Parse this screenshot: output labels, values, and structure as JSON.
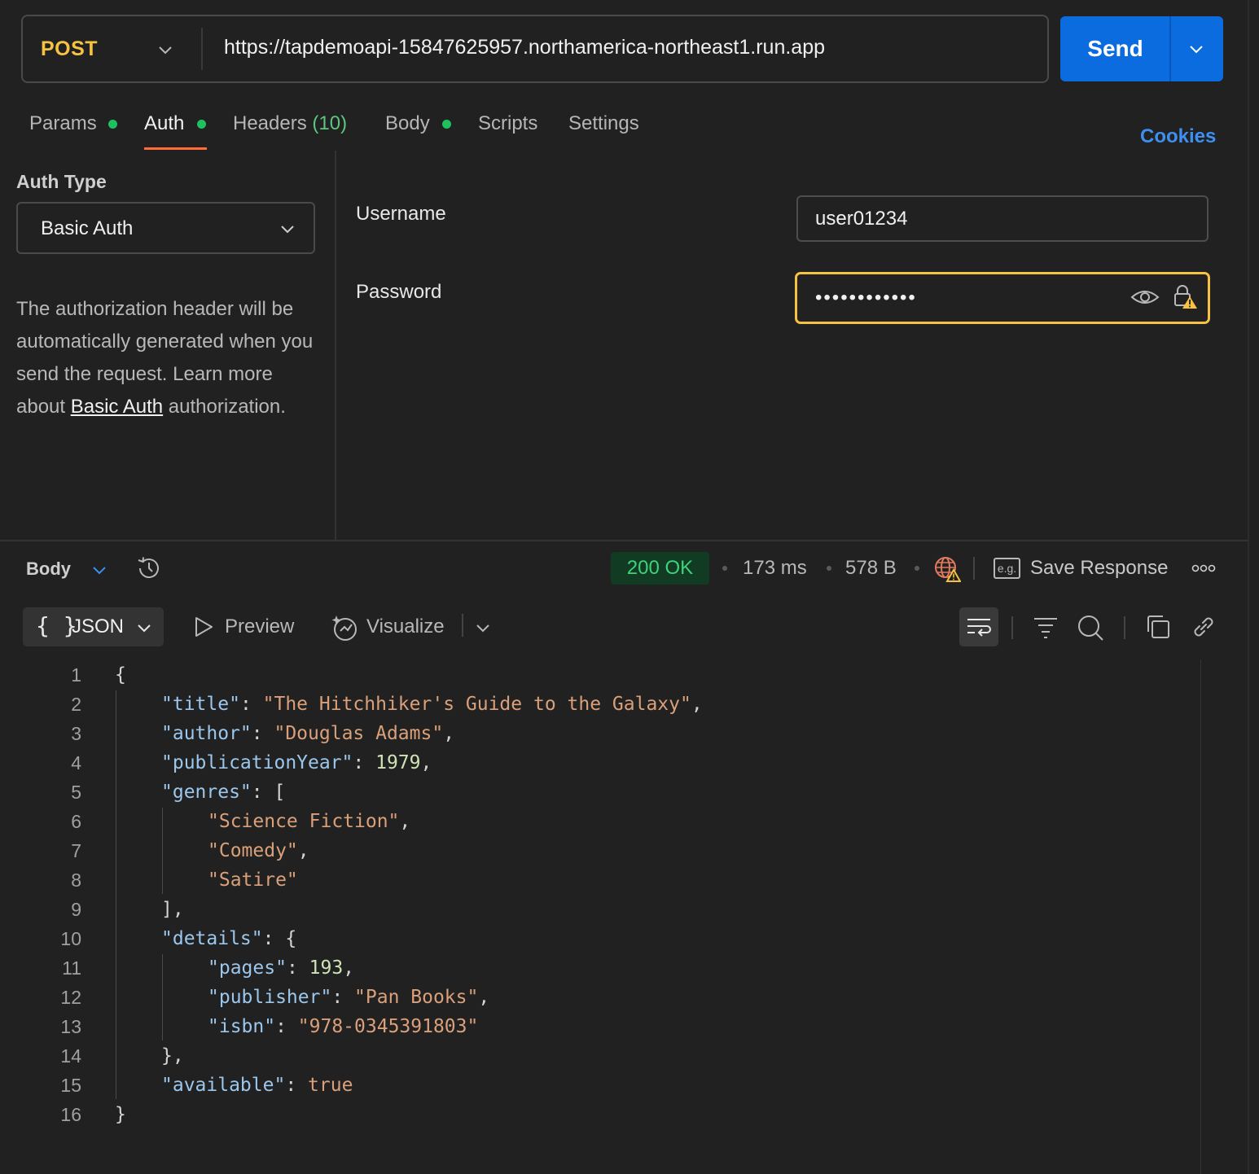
{
  "request": {
    "method": "POST",
    "url": "https://tapdemoapi-15847625957.northamerica-northeast1.run.app",
    "send_label": "Send"
  },
  "tabs": [
    {
      "label": "Params",
      "dot": true
    },
    {
      "label": "Auth",
      "dot": true,
      "active": true
    },
    {
      "label": "Headers",
      "count": "(10)"
    },
    {
      "label": "Body",
      "dot": true
    },
    {
      "label": "Scripts"
    },
    {
      "label": "Settings"
    }
  ],
  "cookies_label": "Cookies",
  "auth": {
    "type_label": "Auth Type",
    "type_value": "Basic Auth",
    "desc_pre": "The authorization header will be automatically generated when you send the request. Learn more about ",
    "desc_link": "Basic Auth",
    "desc_post": " authorization.",
    "username_label": "Username",
    "username_value": "user01234",
    "password_label": "Password",
    "password_value": "••••••••••••"
  },
  "response": {
    "section_label": "Body",
    "status": "200 OK",
    "time": "173 ms",
    "size": "578 B",
    "eg_label": "e.g.",
    "save_label": "Save Response",
    "format_label": "JSON",
    "braces": "{ }",
    "preview_label": "Preview",
    "visualize_label": "Visualize"
  },
  "colors": {
    "accent": "#0b6ce0",
    "method": "#f5c242",
    "status_ok": "#3fd27a",
    "tab_underline": "#ff6c37",
    "dot": "#1ec15f"
  },
  "code_lines": [
    {
      "n": "1",
      "indent": 0,
      "parts": [
        [
          "p",
          "{"
        ]
      ]
    },
    {
      "n": "2",
      "indent": 1,
      "parts": [
        [
          "k",
          "\"title\""
        ],
        [
          "p",
          ": "
        ],
        [
          "s",
          "\"The Hitchhiker's Guide to the Galaxy\""
        ],
        [
          "p",
          ","
        ]
      ]
    },
    {
      "n": "3",
      "indent": 1,
      "parts": [
        [
          "k",
          "\"author\""
        ],
        [
          "p",
          ": "
        ],
        [
          "s",
          "\"Douglas Adams\""
        ],
        [
          "p",
          ","
        ]
      ]
    },
    {
      "n": "4",
      "indent": 1,
      "parts": [
        [
          "k",
          "\"publicationYear\""
        ],
        [
          "p",
          ": "
        ],
        [
          "n",
          "1979"
        ],
        [
          "p",
          ","
        ]
      ]
    },
    {
      "n": "5",
      "indent": 1,
      "parts": [
        [
          "k",
          "\"genres\""
        ],
        [
          "p",
          ": ["
        ]
      ]
    },
    {
      "n": "6",
      "indent": 2,
      "parts": [
        [
          "s",
          "\"Science Fiction\""
        ],
        [
          "p",
          ","
        ]
      ]
    },
    {
      "n": "7",
      "indent": 2,
      "parts": [
        [
          "s",
          "\"Comedy\""
        ],
        [
          "p",
          ","
        ]
      ]
    },
    {
      "n": "8",
      "indent": 2,
      "parts": [
        [
          "s",
          "\"Satire\""
        ]
      ]
    },
    {
      "n": "9",
      "indent": 1,
      "parts": [
        [
          "p",
          "],"
        ]
      ]
    },
    {
      "n": "10",
      "indent": 1,
      "parts": [
        [
          "k",
          "\"details\""
        ],
        [
          "p",
          ": {"
        ]
      ]
    },
    {
      "n": "11",
      "indent": 2,
      "parts": [
        [
          "k",
          "\"pages\""
        ],
        [
          "p",
          ": "
        ],
        [
          "n",
          "193"
        ],
        [
          "p",
          ","
        ]
      ]
    },
    {
      "n": "12",
      "indent": 2,
      "parts": [
        [
          "k",
          "\"publisher\""
        ],
        [
          "p",
          ": "
        ],
        [
          "s",
          "\"Pan Books\""
        ],
        [
          "p",
          ","
        ]
      ]
    },
    {
      "n": "13",
      "indent": 2,
      "parts": [
        [
          "k",
          "\"isbn\""
        ],
        [
          "p",
          ": "
        ],
        [
          "s",
          "\"978-0345391803\""
        ]
      ]
    },
    {
      "n": "14",
      "indent": 1,
      "parts": [
        [
          "p",
          "},"
        ]
      ]
    },
    {
      "n": "15",
      "indent": 1,
      "parts": [
        [
          "k",
          "\"available\""
        ],
        [
          "p",
          ": "
        ],
        [
          "b",
          "true"
        ]
      ]
    },
    {
      "n": "16",
      "indent": 0,
      "parts": [
        [
          "p",
          "}"
        ]
      ]
    }
  ]
}
